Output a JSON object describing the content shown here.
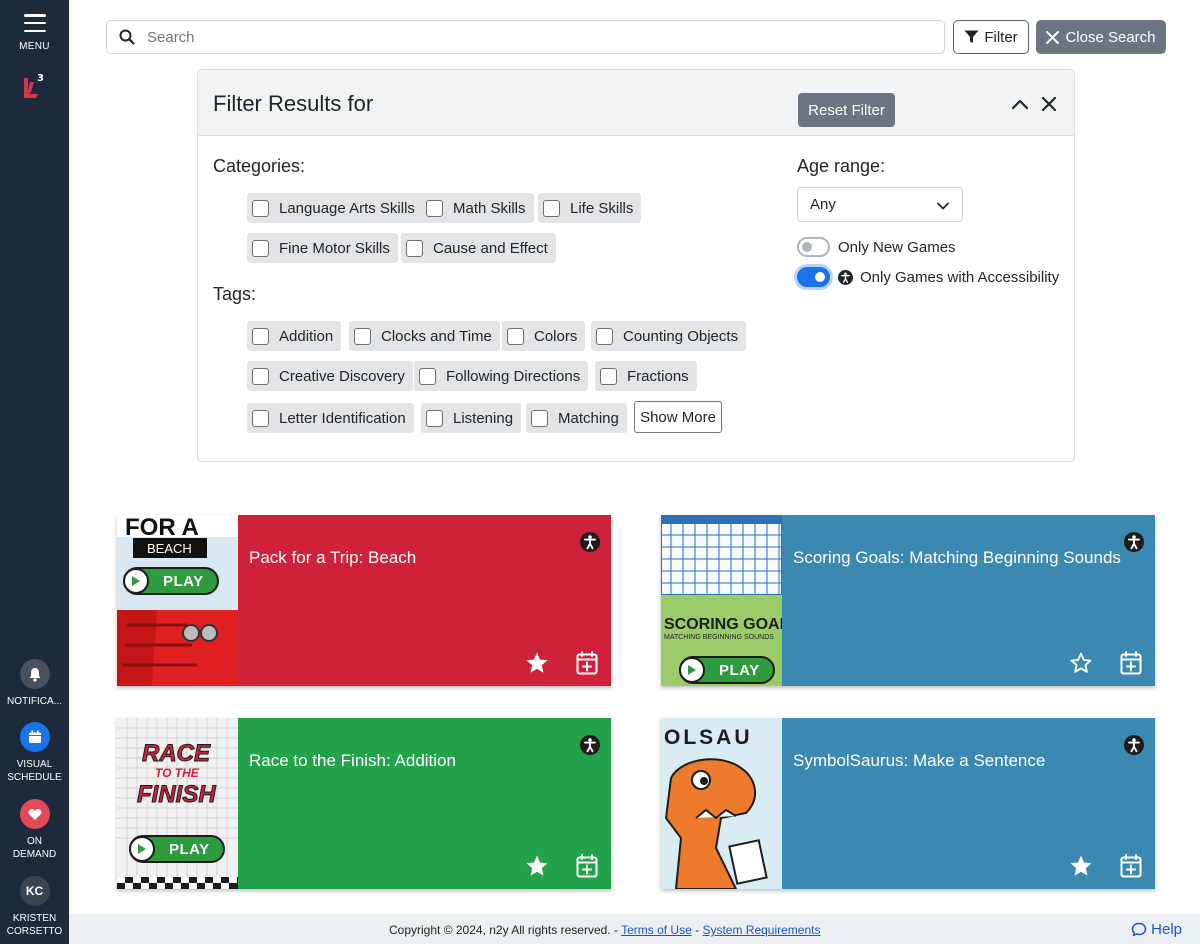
{
  "sidebar": {
    "menu_label": "MENU",
    "items": [
      {
        "label": "NOTIFICA...",
        "icon": "bell-icon",
        "color": "#4a5260"
      },
      {
        "label": "VISUAL\nSCHEDULE",
        "icon": "calendar-icon",
        "color": "#1a73e8"
      },
      {
        "label": "ON\nDEMAND",
        "icon": "heart-icon",
        "color": "#e04a5a"
      },
      {
        "label": "KRISTEN\nCORSETTO",
        "initials": "KC",
        "icon": "avatar",
        "color": "#3a4350"
      }
    ]
  },
  "search": {
    "placeholder": "Search",
    "value": ""
  },
  "toolbar": {
    "filter_label": "Filter",
    "close_search_label": "Close Search"
  },
  "filter_panel": {
    "title": "Filter Results for",
    "reset_label": "Reset Filter",
    "categories_label": "Categories:",
    "categories": [
      "Language Arts Skills",
      "Math Skills",
      "Life Skills",
      "Fine Motor Skills",
      "Cause and Effect"
    ],
    "tags_label": "Tags:",
    "tags": [
      "Addition",
      "Clocks and Time",
      "Colors",
      "Counting Objects",
      "Creative Discovery",
      "Following Directions",
      "Fractions",
      "Letter Identification",
      "Listening",
      "Matching"
    ],
    "show_more_label": "Show More",
    "age_range_label": "Age range:",
    "age_range_value": "Any",
    "only_new_games_label": "Only New Games",
    "only_new_games_on": false,
    "only_accessibility_label": "Only Games with Accessibility",
    "only_accessibility_on": true
  },
  "games": [
    {
      "title": "Pack for a Trip: Beach",
      "color": "#d0213a",
      "favorite": true,
      "thumb_text": "BEACH",
      "thumb_top": "FOR A"
    },
    {
      "title": "Scoring Goals: Matching Beginning Sounds",
      "color": "#3b89b0",
      "favorite": false,
      "thumb_text": "SCORING GOALS",
      "thumb_sub": "MATCHING BEGINNING SOUNDS"
    },
    {
      "title": "Race to the Finish: Addition",
      "color": "#22a24a",
      "favorite": true,
      "thumb_text": "RACE",
      "thumb_sub": "TO THE",
      "thumb_sub2": "FINISH"
    },
    {
      "title": "SymbolSaurus: Make a Sentence",
      "color": "#3b89b0",
      "favorite": true,
      "thumb_text": "OLSAU"
    }
  ],
  "play_label": "PLAY",
  "footer": {
    "copyright": "Copyright © 2024, n2y All rights reserved. - ",
    "terms_label": "Terms of Use",
    "separator": " - ",
    "system_req_label": "System Requirements",
    "help_label": "Help"
  }
}
